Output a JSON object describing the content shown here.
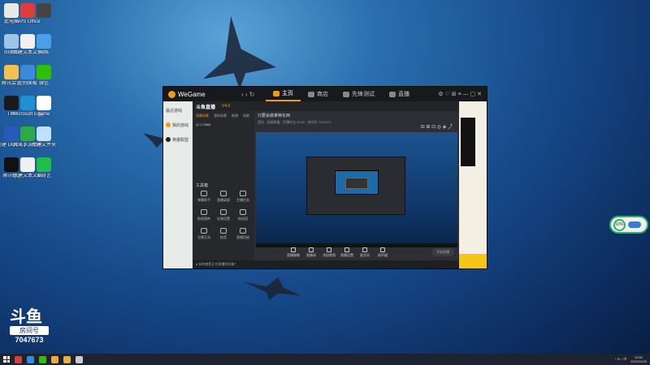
{
  "desktop": {
    "icons": [
      {
        "label": "此电脑",
        "color": "#e8e8e8"
      },
      {
        "label": "WPS Office",
        "color": "#e03a3a"
      },
      {
        "label": "",
        "color": "#444444"
      },
      {
        "label": "回收站",
        "color": "#9ec5e8"
      },
      {
        "label": "新建文本文档",
        "color": "#f0f0f0"
      },
      {
        "label": "网络",
        "color": "#4aa0e6"
      },
      {
        "label": "腾讯会议",
        "color": "#f2c14e"
      },
      {
        "label": "控制面板",
        "color": "#3a8ad6"
      },
      {
        "label": "微信",
        "color": "#2dc100"
      },
      {
        "label": "TIM",
        "color": "#1a1a1a"
      },
      {
        "label": "Microsoft Edge",
        "color": "#1e90d8"
      },
      {
        "label": "game",
        "color": "#ffffff"
      },
      {
        "label": "新建 DOCX 文档",
        "color": "#2a5ab8"
      },
      {
        "label": "腾讯手游助手",
        "color": "#2ea84a"
      },
      {
        "label": "新建文件夹",
        "color": "#c0e0ff"
      },
      {
        "label": "腾讯QQ",
        "color": "#111111"
      },
      {
        "label": "新建文本文档",
        "color": "#f0f0f0"
      },
      {
        "label": "爱奇艺",
        "color": "#1cbf4a"
      }
    ]
  },
  "wegame": {
    "brand": "WeGame",
    "nav": "‹  ›  ↻",
    "tabs": [
      {
        "label": "主页",
        "active": true
      },
      {
        "label": "商店",
        "active": false
      },
      {
        "label": "先锋测试",
        "active": false
      },
      {
        "label": "直播",
        "active": false
      }
    ],
    "window_controls": "⚙ ♡ ⊞ ≡ — ▢ ✕",
    "left_items": [
      "最近游戏",
      "我的游戏",
      "英雄联盟"
    ]
  },
  "douyu_tool": {
    "brand": "斗鱼直播",
    "version": "V4.0",
    "side_tabs": [
      "直播场景",
      "我的场景",
      "新增",
      "场景"
    ],
    "scene_name": "◎  ☐ 2560",
    "toolbox_title": "工具箱",
    "tools": [
      "弹幕助手",
      "直播录屏",
      "主播任务",
      "贴纸图库",
      "礼物设置",
      "粉丝团",
      "主播互动",
      "抽奖",
      "直播回放"
    ],
    "room_title": "只要会做某种东西",
    "room_meta": "竞技 · 英雄联盟  ·  开播时长 00:00  ·  房间号 7047673",
    "header_icons": "⊟ ⊞ ⊡ ◎ ◈ ⤴",
    "controls": [
      "直播摄像",
      "直播录",
      "添加视频",
      "直播设置",
      "麦克风",
      "扬声器"
    ],
    "live_button": "开始直播",
    "status_text": "● 如何使用正在直播的功能？"
  },
  "douyu_badge": {
    "logo": "斗鱼",
    "room_label": "房间号",
    "room_number": "7047673"
  },
  "float_widget": {
    "percent": "10%"
  },
  "taskbar": {
    "apps": [
      {
        "color": "#e03a3a"
      },
      {
        "color": "#2a8ee6"
      },
      {
        "color": "#2dc100"
      },
      {
        "color": "#f2a93b"
      },
      {
        "color": "#e8b23a"
      },
      {
        "color": "#cccccc"
      }
    ],
    "tray": "^  ⊡  ♪  中",
    "time": "18:52",
    "date": "2021/11/26"
  }
}
